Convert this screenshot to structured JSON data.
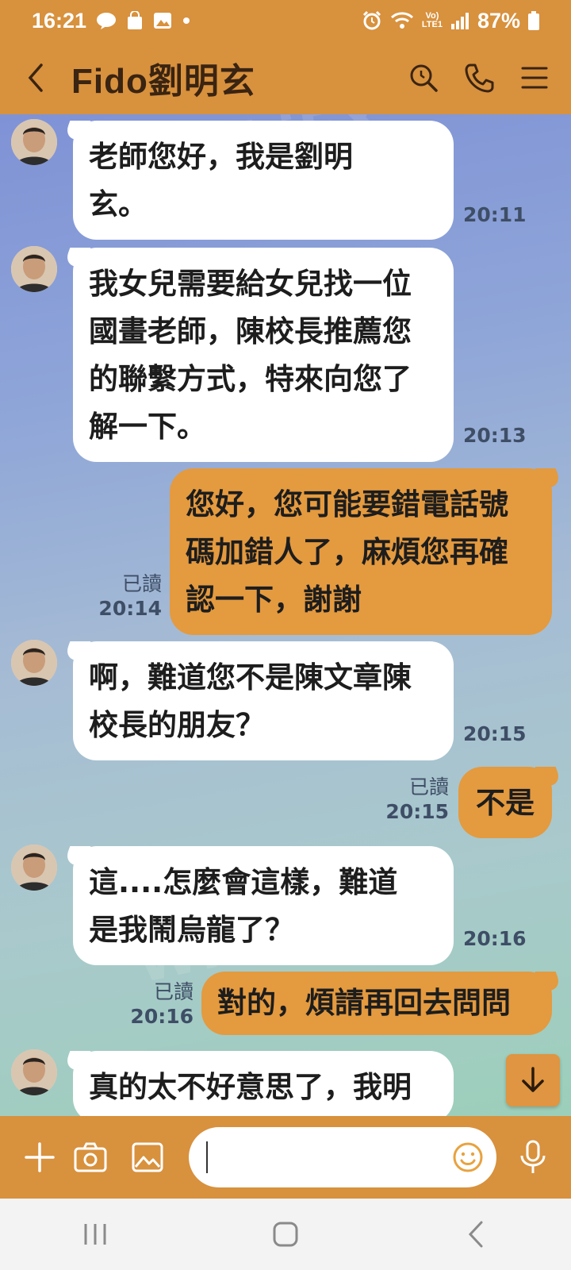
{
  "status_bar": {
    "time": "16:21",
    "battery": "87%",
    "network_line1": "Vo)",
    "network_line2": "LTE1"
  },
  "header": {
    "title": "Fido劉明玄"
  },
  "messages": [
    {
      "side": "in",
      "text_lines": [
        "老師您好，我是劉明",
        "玄。"
      ],
      "time": "20:11"
    },
    {
      "side": "in",
      "text_lines": [
        "我女兒需要給女兒找一位",
        "國畫老師，陳校長推薦您",
        "的聯繫方式，特來向您了",
        "解一下。"
      ],
      "time": "20:13"
    },
    {
      "side": "out",
      "text_lines": [
        "您好，您可能要錯電話號",
        "碼加錯人了，麻煩您再確",
        "認一下，謝謝"
      ],
      "read": "已讀",
      "time": "20:14"
    },
    {
      "side": "in",
      "text_lines": [
        "啊，難道您不是陳文章陳",
        "校長的朋友？"
      ],
      "time": "20:15"
    },
    {
      "side": "out",
      "text_lines": [
        "不是"
      ],
      "read": "已讀",
      "time": "20:15"
    },
    {
      "side": "in",
      "text_lines": [
        "這....怎麼會這樣，難道",
        "是我鬧烏龍了？"
      ],
      "time": "20:16"
    },
    {
      "side": "out",
      "text_lines": [
        "對的，煩請再回去問問"
      ],
      "read": "已讀",
      "time": "20:16"
    },
    {
      "side": "in",
      "text_lines": [
        "真的太不好意思了，我明"
      ],
      "time": ""
    }
  ],
  "input": {
    "value": "",
    "placeholder": ""
  },
  "icons": {
    "back": "chevron-left-icon",
    "search": "search-icon",
    "call": "phone-icon",
    "menu": "menu-icon",
    "plus": "plus-icon",
    "camera": "camera-icon",
    "image": "image-icon",
    "emoji": "emoji-icon",
    "mic": "mic-icon",
    "scroll_down": "arrow-down-icon"
  },
  "colors": {
    "header": "#d8913d",
    "outgoing_bubble": "#e49a3f",
    "incoming_bubble": "#ffffff"
  }
}
